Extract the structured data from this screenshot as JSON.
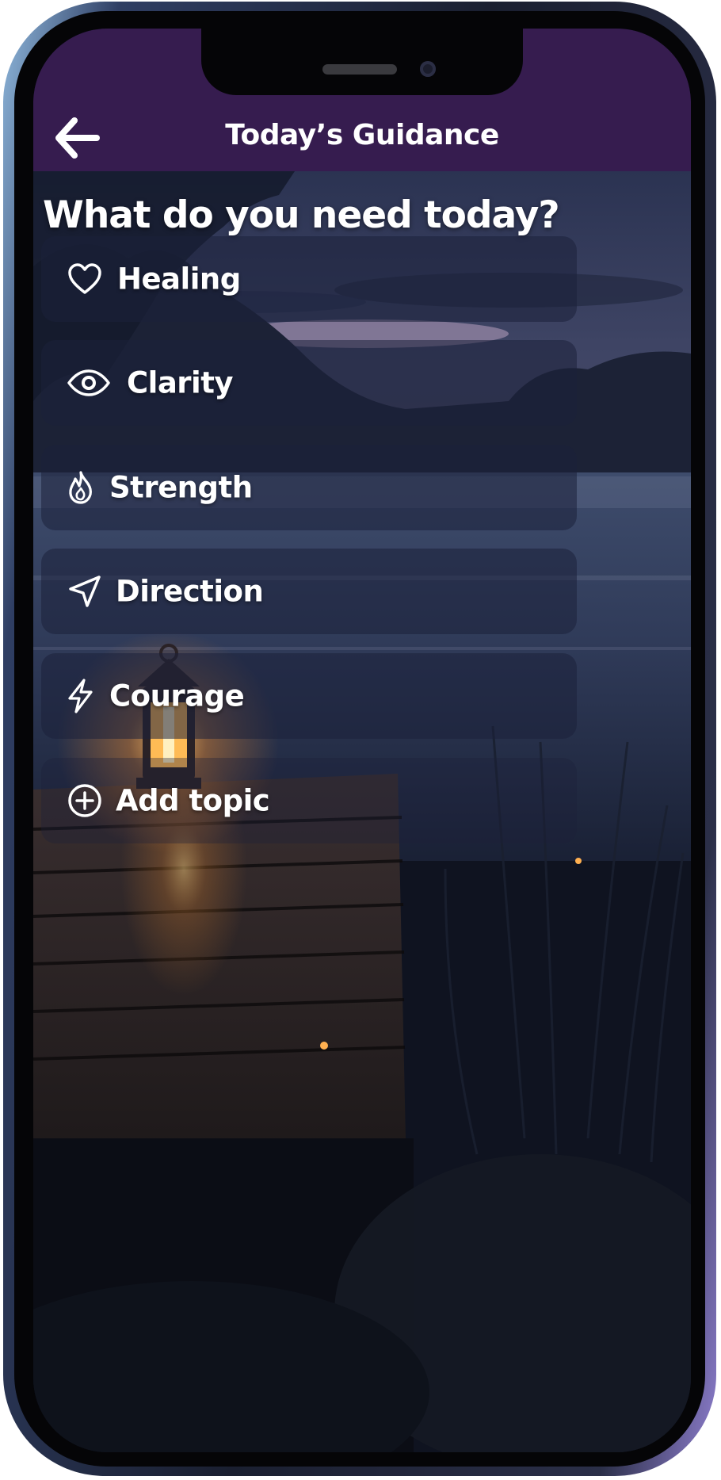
{
  "header": {
    "title": "Today’s Guidance",
    "back_icon": "arrow-left-icon",
    "background": "#361c4f"
  },
  "prompt": "What do you need today?",
  "topics": [
    {
      "label": "Healing",
      "icon": "heart-icon"
    },
    {
      "label": "Clarity",
      "icon": "eye-icon"
    },
    {
      "label": "Strength",
      "icon": "flame-icon"
    },
    {
      "label": "Direction",
      "icon": "navigation-arrow-icon"
    },
    {
      "label": "Courage",
      "icon": "lightning-bolt-icon"
    }
  ],
  "add_topic": {
    "label": "Add topic",
    "icon": "plus-circle-icon"
  }
}
